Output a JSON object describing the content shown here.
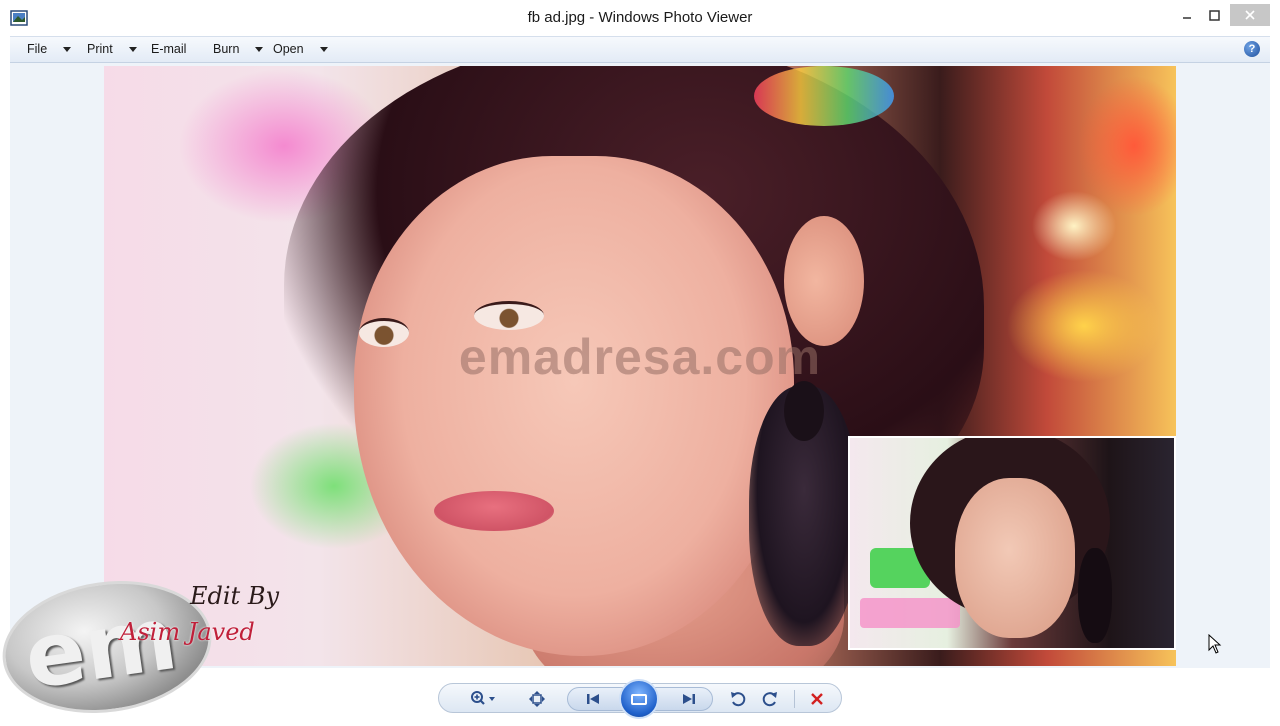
{
  "window": {
    "title": "fb ad.jpg - Windows Photo Viewer",
    "minimize_icon": "minimize-icon",
    "maximize_icon": "maximize-icon",
    "close_icon": "close-icon"
  },
  "menu": {
    "items": [
      {
        "label": "File",
        "has_dropdown": true
      },
      {
        "label": "Print",
        "has_dropdown": true
      },
      {
        "label": "E-mail",
        "has_dropdown": false
      },
      {
        "label": "Burn",
        "has_dropdown": true
      },
      {
        "label": "Open",
        "has_dropdown": true
      }
    ],
    "help_icon": "help-icon"
  },
  "photo": {
    "watermark": "emadresa.com",
    "signature_line1": "Edit By",
    "signature_line2": "Asim Javed"
  },
  "logo": {
    "text": "em"
  },
  "controls": {
    "zoom_icon": "zoom-icon",
    "fit_icon": "actual-size-icon",
    "prev_icon": "previous-icon",
    "slideshow_icon": "slideshow-icon",
    "next_icon": "next-icon",
    "rotate_left_icon": "rotate-counterclockwise-icon",
    "rotate_right_icon": "rotate-clockwise-icon",
    "delete_icon": "delete-icon"
  },
  "colors": {
    "menubar": "#e3ebf6",
    "canvas": "#eef3f9",
    "accent": "#1e5fc9",
    "delete": "#d22020"
  }
}
